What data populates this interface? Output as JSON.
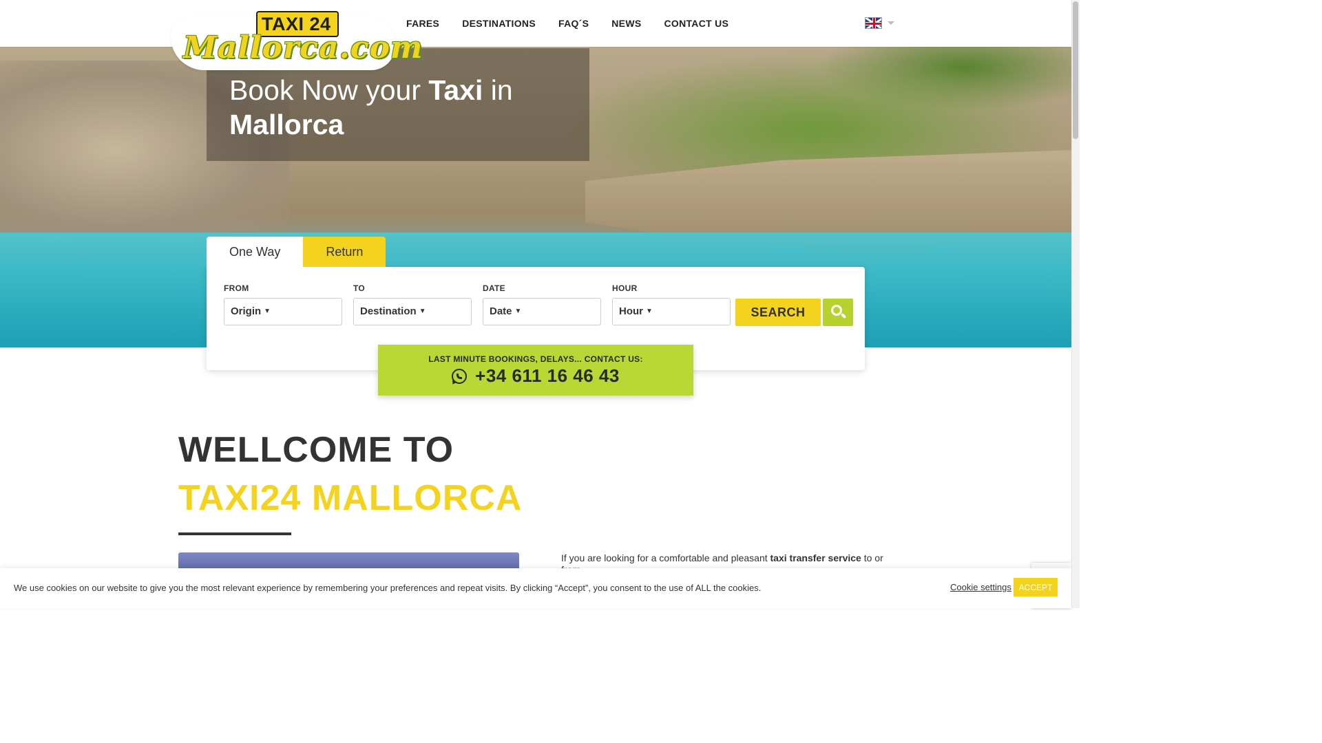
{
  "logo": {
    "badge": "TAXI 24",
    "wordmark": "Mallorca.com"
  },
  "nav": {
    "items": [
      {
        "label": "FARES"
      },
      {
        "label": "DESTINATIONS"
      },
      {
        "label": "FAQ´S"
      },
      {
        "label": "NEWS"
      },
      {
        "label": "CONTACT US"
      }
    ],
    "language_icon": "uk-flag-icon"
  },
  "hero": {
    "title_part1": "Book Now your ",
    "title_bold1": "Taxi",
    "title_part2": " in ",
    "title_bold2": "Mallorca"
  },
  "booking": {
    "tabs": [
      {
        "label": "One Way"
      },
      {
        "label": "Return"
      }
    ],
    "fields": [
      {
        "label": "FROM",
        "value": "Origin"
      },
      {
        "label": "TO",
        "value": "Destination"
      },
      {
        "label": "DATE",
        "value": "Date"
      },
      {
        "label": "HOUR",
        "value": "Hour"
      }
    ],
    "search_label": "SEARCH",
    "dropdown_arrow": "▼"
  },
  "contact": {
    "label": "LAST MINUTE BOOKINGS, DELAYS... CONTACT US:",
    "phone": "+34 611 16 46 43",
    "icon": "whatsapp-icon"
  },
  "welcome": {
    "line1": "WELLCOME TO",
    "line2": "TAXI24 MALLORCA",
    "intro_1": "If you are looking for a comfortable and pleasant ",
    "intro_bold": "taxi transfer service",
    "intro_2": " to or from"
  },
  "cookie": {
    "text": "We use cookies on our website to give you the most relevant experience by remembering your preferences and repeat visits. By clicking “Accept”, you consent to the use of ALL the cookies.",
    "settings_label": "Cookie settings",
    "accept_label": "ACCEPT"
  },
  "colors": {
    "brand_yellow": "#f4d31f",
    "brand_green": "#b9d735",
    "text_dark": "#333333"
  }
}
